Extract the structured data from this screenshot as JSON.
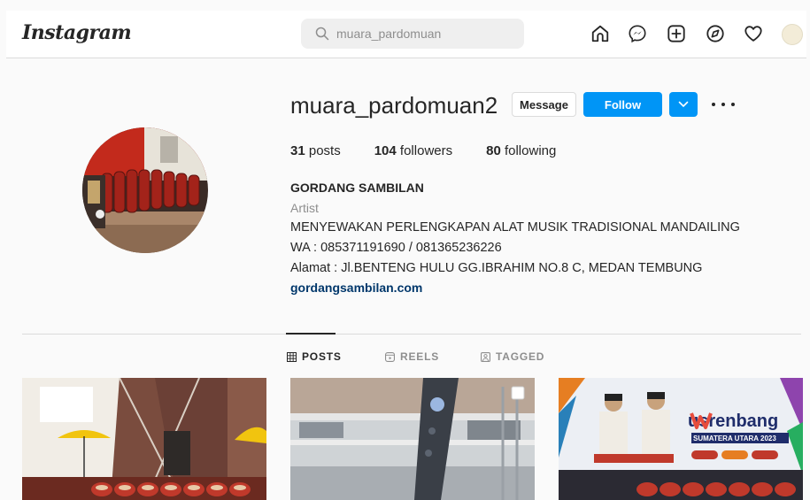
{
  "header": {
    "logo": "Instagram",
    "search_placeholder": "muara_pardomuan",
    "icons": [
      "home-icon",
      "messenger-icon",
      "new-post-icon",
      "explore-icon",
      "activity-icon",
      "profile-avatar"
    ]
  },
  "profile": {
    "username": "muara_pardomuan2",
    "message_label": "Message",
    "follow_label": "Follow",
    "stats": [
      {
        "count": "31",
        "label": "posts"
      },
      {
        "count": "104",
        "label": "followers"
      },
      {
        "count": "80",
        "label": "following"
      }
    ],
    "display_name": "GORDANG SAMBILAN",
    "category": "Artist",
    "bio": [
      "MENYEWAKAN PERLENGKAPAN ALAT MUSIK TRADISIONAL MANDAILING",
      "WA : 085371191690 / 081365236226",
      "Alamat : Jl.BENTENG HULU GG.IBRAHIM NO.8 C, MEDAN TEMBUNG"
    ],
    "website": "gordangsambilan.com"
  },
  "tabs": [
    {
      "label": "POSTS",
      "active": true
    },
    {
      "label": "REELS",
      "active": false
    },
    {
      "label": "TAGGED",
      "active": false
    }
  ],
  "posts": [
    {
      "name": "post-gordang-hall"
    },
    {
      "name": "post-mall-interior"
    },
    {
      "name": "post-musrenbang",
      "banner_text": "usrenbang",
      "banner_sub": "SUMATERA UTARA 2023"
    }
  ],
  "colors": {
    "accent": "#0095f6",
    "link": "#00376b",
    "text": "#262626",
    "muted": "#8e8e8e"
  }
}
